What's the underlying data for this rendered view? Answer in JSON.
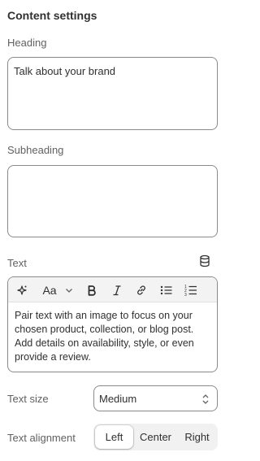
{
  "section": {
    "title": "Content settings"
  },
  "heading": {
    "label": "Heading",
    "value": "Talk about your brand"
  },
  "subheading": {
    "label": "Subheading",
    "value": ""
  },
  "text": {
    "label": "Text",
    "content": "Pair text with an image to focus on your chosen product, collection, or blog post. Add details on availability, style, or even provide a review."
  },
  "toolbar": {
    "ai": "sparkle-icon",
    "format": "Aa",
    "buttons": [
      "bold-icon",
      "italic-icon",
      "link-icon",
      "bullet-list-icon",
      "numbered-list-icon"
    ]
  },
  "text_size": {
    "label": "Text size",
    "selected": "Medium"
  },
  "text_alignment": {
    "label": "Text alignment",
    "options": [
      "Left",
      "Center",
      "Right"
    ],
    "selected": "Left"
  },
  "colors": {
    "border": "#8a8a8a",
    "label": "#616161",
    "text": "#303030",
    "toolbar_bg": "#f3f3f3"
  }
}
